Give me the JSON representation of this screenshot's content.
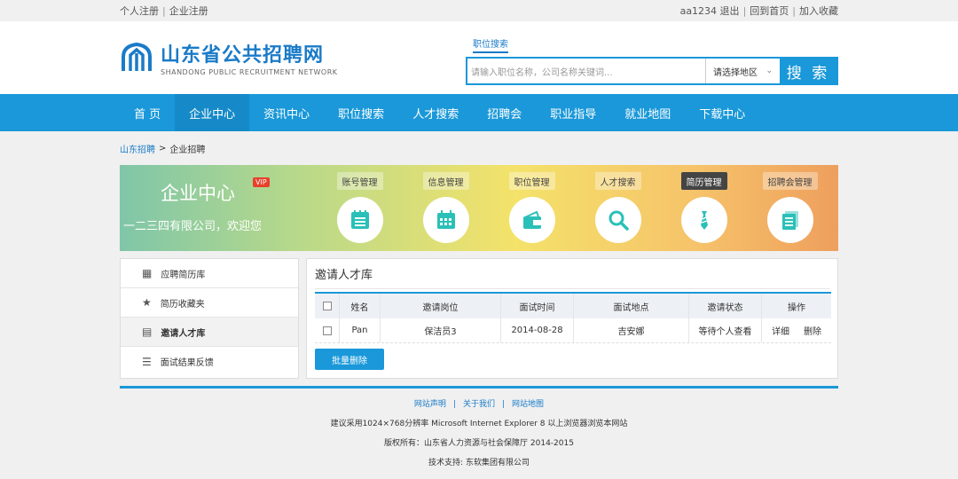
{
  "topbar": {
    "left": [
      "个人注册",
      "企业注册"
    ],
    "right": [
      "aa1234 退出",
      "回到首页",
      "加入收藏"
    ]
  },
  "logo": {
    "cn": "山东省公共招聘网",
    "en": "SHANDONG PUBLIC RECRUITMENT NETWORK"
  },
  "search": {
    "tab": "职位搜索",
    "placeholder": "请输入职位名称，公司名称关键词...",
    "region": "请选择地区",
    "button": "搜 索"
  },
  "nav": [
    "首 页",
    "企业中心",
    "资讯中心",
    "职位搜索",
    "人才搜索",
    "招聘会",
    "职业指导",
    "就业地图",
    "下载中心"
  ],
  "breadcrumb": {
    "home": "山东招聘",
    "sep": ">",
    "current": "企业招聘"
  },
  "banner": {
    "title": "企业中心",
    "vip": "VIP",
    "welcome": "一二三四有限公司，欢迎您",
    "modules": [
      "账号管理",
      "信息管理",
      "职位管理",
      "人才搜索",
      "简历管理",
      "招聘会管理"
    ]
  },
  "sidebar": [
    "应聘简历库",
    "简历收藏夹",
    "邀请人才库",
    "面试结果反馈"
  ],
  "main": {
    "title": "邀请人才库",
    "columns": [
      "姓名",
      "邀请岗位",
      "面试时间",
      "面试地点",
      "邀请状态",
      "操作"
    ],
    "rows": [
      {
        "name": "Pan",
        "position": "保洁员3",
        "time": "2014-08-28",
        "place": "吉安娜",
        "status": "等待个人查看",
        "op1": "详细",
        "op2": "删除"
      }
    ],
    "bulk": "批量删除"
  },
  "footer": {
    "links": [
      "网站声明",
      "关于我们",
      "网站地图"
    ],
    "line1": "建议采用1024×768分辨率 Microsoft Internet Explorer 8 以上浏览器浏览本网站",
    "line2": "版权所有：山东省人力资源与社会保障厅 2014-2015",
    "line3": "技术支持: 东软集团有限公司"
  },
  "colors": {
    "primary": "#1a98d9",
    "vip": "#e8402b"
  }
}
